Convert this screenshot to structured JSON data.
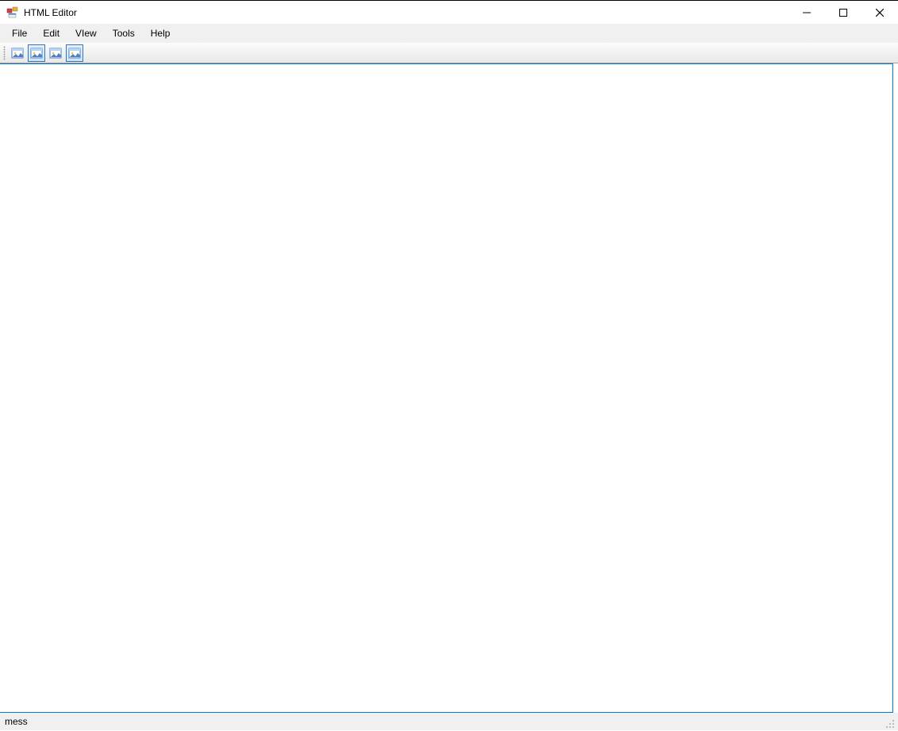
{
  "window": {
    "title": "HTML Editor"
  },
  "menu": {
    "items": [
      "File",
      "Edit",
      "VIew",
      "Tools",
      "Help"
    ]
  },
  "toolbar": {
    "buttons": [
      {
        "name": "tool-button-1",
        "selected": false
      },
      {
        "name": "tool-button-2",
        "selected": true
      },
      {
        "name": "tool-button-3",
        "selected": false
      },
      {
        "name": "tool-button-4",
        "selected": true
      }
    ]
  },
  "statusbar": {
    "text": "mess"
  }
}
